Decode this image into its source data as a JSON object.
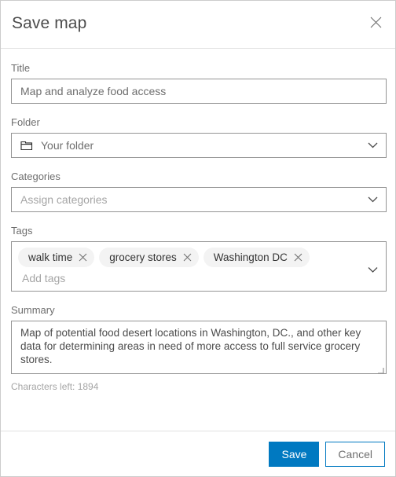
{
  "dialog": {
    "title": "Save map",
    "close_icon": "close-icon"
  },
  "fields": {
    "title": {
      "label": "Title",
      "value": "Map and analyze food access"
    },
    "folder": {
      "label": "Folder",
      "value": "Your folder",
      "icon": "folder-icon",
      "chevron": "chevron-down-icon"
    },
    "categories": {
      "label": "Categories",
      "placeholder": "Assign categories",
      "chevron": "chevron-down-icon"
    },
    "tags": {
      "label": "Tags",
      "chips": [
        {
          "label": "walk time",
          "remove_icon": "close-icon"
        },
        {
          "label": "grocery stores",
          "remove_icon": "close-icon"
        },
        {
          "label": "Washington DC",
          "remove_icon": "close-icon"
        }
      ],
      "placeholder": "Add tags",
      "chevron": "chevron-down-icon"
    },
    "summary": {
      "label": "Summary",
      "value": "Map of potential food desert locations in Washington, DC., and other key data for determining areas in need of more access to full service grocery stores.",
      "characters_left": "Characters left: 1894"
    }
  },
  "footer": {
    "save_label": "Save",
    "cancel_label": "Cancel"
  },
  "colors": {
    "accent": "#0079c1",
    "border": "#949494",
    "label_text": "#6e6e6e",
    "chip_bg": "#f3f3f3"
  }
}
